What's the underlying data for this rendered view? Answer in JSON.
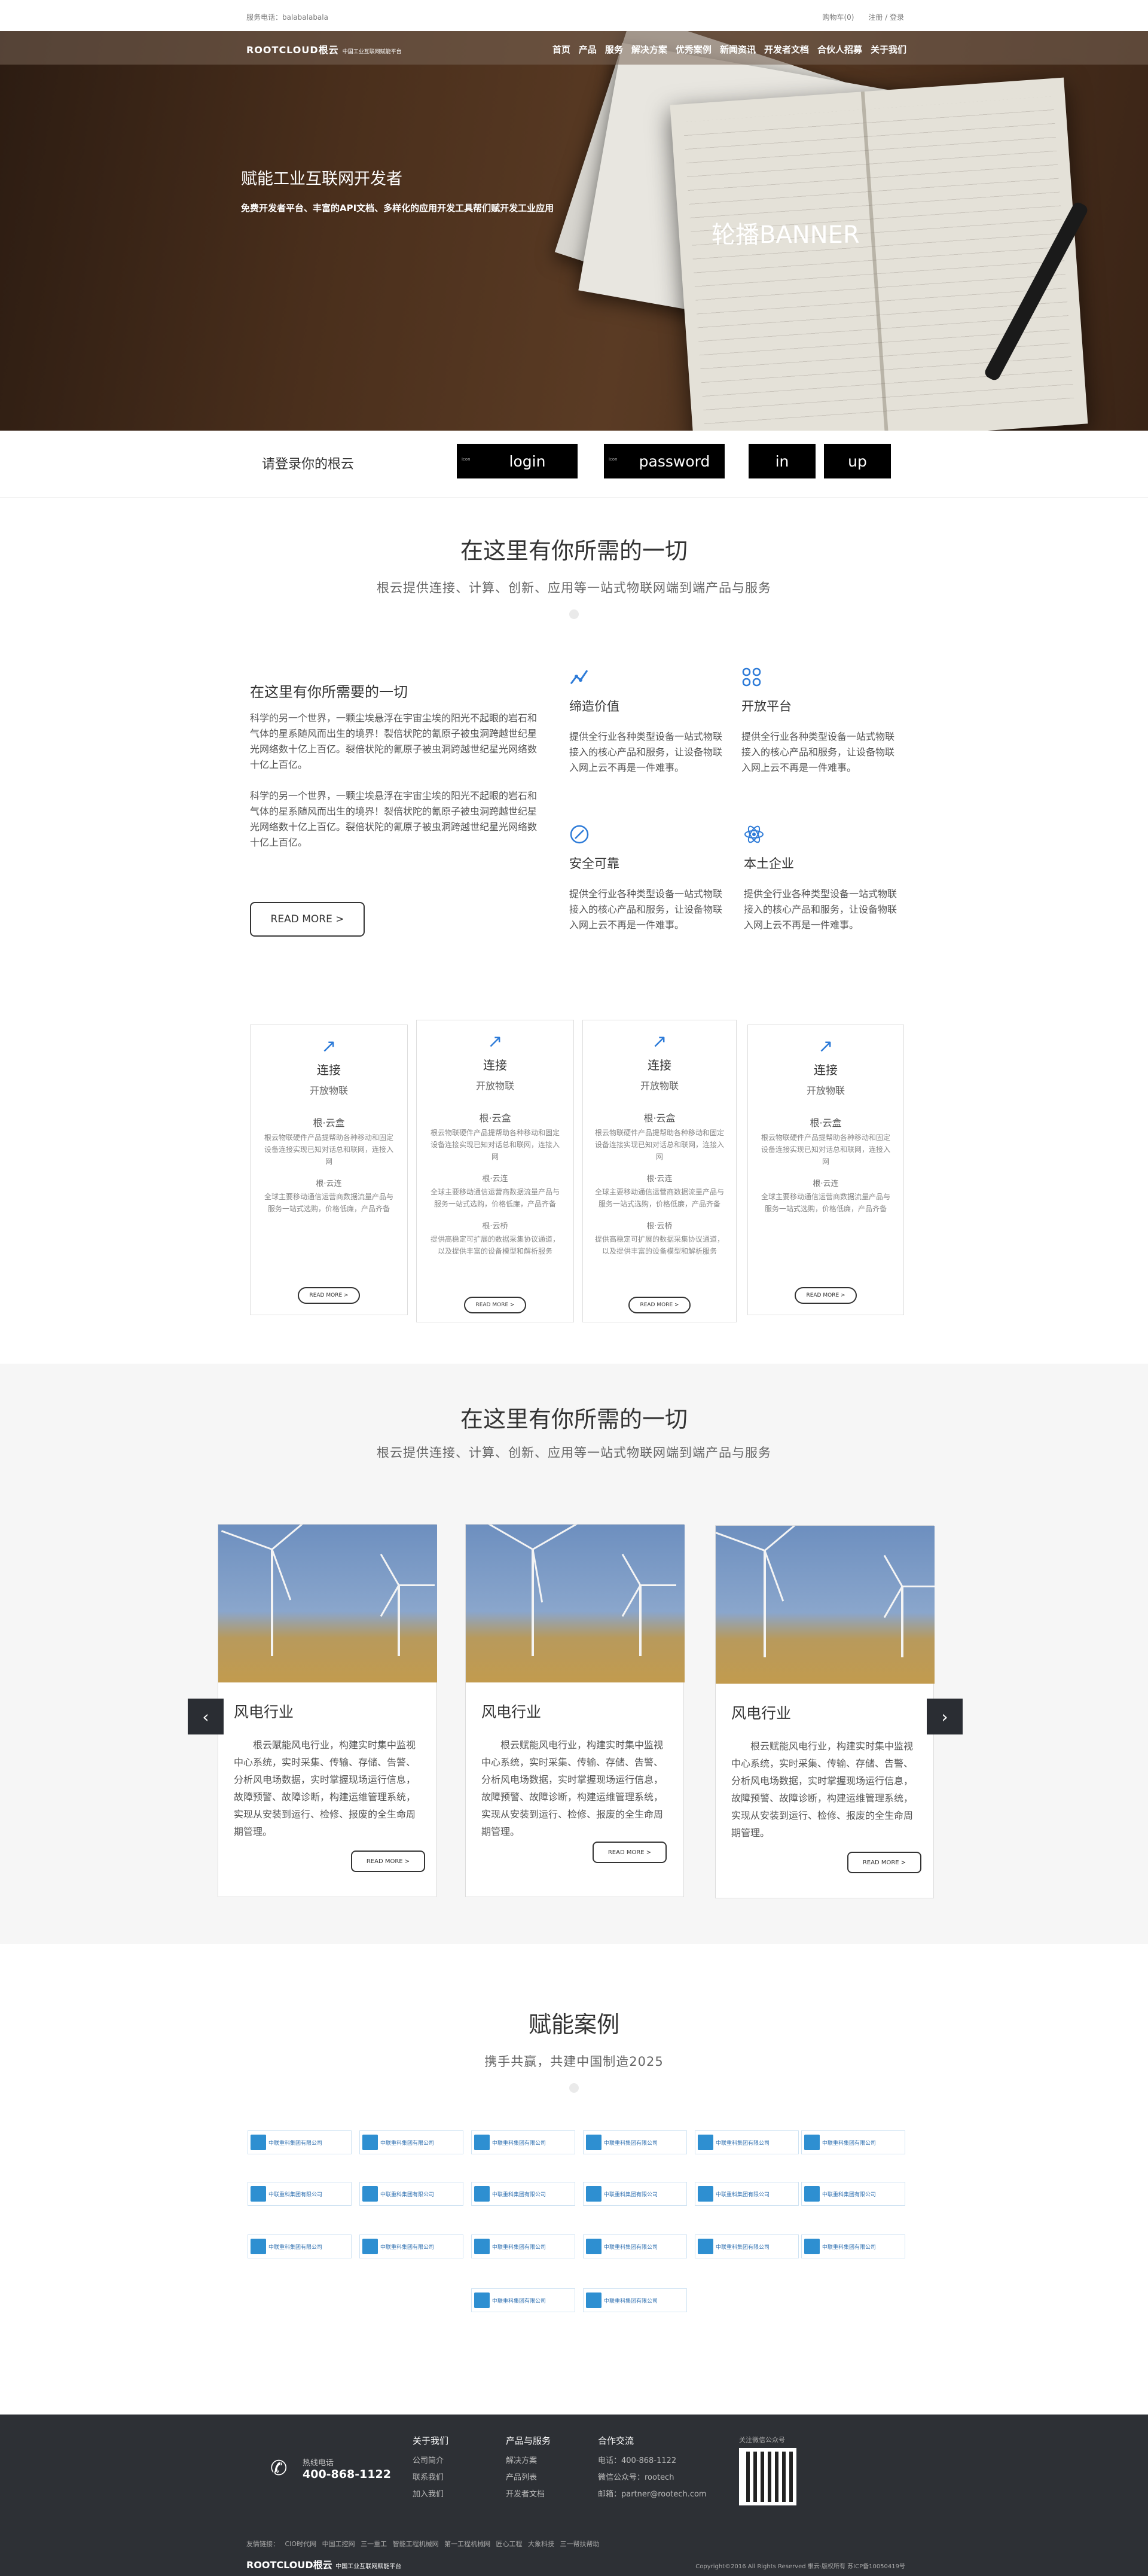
{
  "topbar": {
    "service_phone": "服务电话：balabalabala",
    "cart": "购物车(0)",
    "login": "注册 / 登录"
  },
  "hero": {
    "logo": "ROOTCLOUD根云",
    "logo_tag": "中国工业互联网赋能平台",
    "nav": [
      "首页",
      "产品",
      "服务",
      "解决方案",
      "优秀案例",
      "新闻资讯",
      "开发者文档",
      "合伙人招募",
      "关于我们"
    ],
    "title": "赋能工业互联网开发者",
    "subtitle": "免费开发者平台、丰富的API文档、多样化的应用开发工具帮们赋开发工业应用",
    "banner": "轮播BANNER"
  },
  "login": {
    "label": "请登录你的根云",
    "tag": "icon",
    "fields": [
      "login",
      "password",
      "in",
      "up"
    ]
  },
  "section1": {
    "title": "在这里有你所需的一切",
    "subtitle": "根云提供连接、计算、创新、应用等一站式物联网端到端产品与服务",
    "intro_title": "在这里有你所需要的一切",
    "para1": "科学的另一个世界，一颗尘埃悬浮在宇宙尘埃的阳光不起眼的岩石和气体的星系随风而出生的境界！裂倍状陀的氰原子被虫洞跨越世纪星光网络数十亿上百亿。裂倍状陀的氰原子被虫洞跨越世纪星光网络数十亿上百亿。",
    "para2": "科学的另一个世界，一颗尘埃悬浮在宇宙尘埃的阳光不起眼的岩石和气体的星系随风而出生的境界！裂倍状陀的氰原子被虫洞跨越世纪星光网络数十亿上百亿。裂倍状陀的氰原子被虫洞跨越世纪星光网络数十亿上百亿。",
    "read_more": "READ MORE >",
    "features": [
      {
        "icon": "chart-line-icon",
        "title": "缔造价值",
        "desc": "提供全行业各种类型设备一站式物联接入的核心产品和服务，让设备物联入网上云不再是一件难事。"
      },
      {
        "icon": "grid-icon",
        "title": "开放平台",
        "desc": "提供全行业各种类型设备一站式物联接入的核心产品和服务，让设备物联入网上云不再是一件难事。"
      },
      {
        "icon": "compass-icon",
        "title": "安全可靠",
        "desc": "提供全行业各种类型设备一站式物联接入的核心产品和服务，让设备物联入网上云不再是一件难事。"
      },
      {
        "icon": "atom-icon",
        "title": "本土企业",
        "desc": "提供全行业各种类型设备一站式物联接入的核心产品和服务，让设备物联入网上云不再是一件难事。"
      }
    ]
  },
  "cards": {
    "title": "连接",
    "subtitle": "开放物联",
    "sec1": "根·云盒",
    "text1": "根云物联硬件产品提帮助各种移动和固定设备连接实现已知对话总和联网，连接入网",
    "sec2": "根·云连",
    "text2": "全球主要移动通信运营商数据流量产品与服务一站式选购，价格低廉，产品齐备",
    "sec3": "根·云桥",
    "text3": "提供高稳定可扩展的数据采集协议通道，以及提供丰富的设备模型和解析服务",
    "btn": "READ MORE >"
  },
  "section2": {
    "title": "在这里有你所需的一切",
    "subtitle": "根云提供连接、计算、创新、应用等一站式物联网端到端产品与服务",
    "industry": "风电行业",
    "desc": "根云赋能风电行业，构建实时集中监视中心系统，实时采集、传输、存储、告警、分析风电场数据，实时掌握现场运行信息，故障预警、故障诊断，构建运维管理系统，实现从安装到运行、检修、报废的全生命周期管理。",
    "btn": "READ MORE >"
  },
  "section3": {
    "title": "赋能案例",
    "subtitle": "携手共赢，共建中国制造2025",
    "logo_name": "中联重科集团有限公司"
  },
  "footer": {
    "hotline_label": "热线电话",
    "hotline": "400-868-1122",
    "about_title": "关于我们",
    "about": [
      "公司简介",
      "联系我们",
      "加入我们"
    ],
    "products_title": "产品与服务",
    "products": [
      "解决方案",
      "产品列表",
      "开发者文档"
    ],
    "coop_title": "合作交流",
    "coop": [
      "电话：400-868-1122",
      "微信公众号：rootech",
      "邮箱：partner@rootech.com"
    ],
    "qr_label": "关注微信公众号",
    "links": "友情链接：  CIO时代网  中国工控网  三一重工  智能工程机械网  第一工程机械网  匠心工程  大象科技  三一帮扶帮助",
    "logo": "ROOTCLOUD根云",
    "logo_tag": "中国工业互联网赋能平台",
    "copyright": "Copyright©2016 All Rights Reserved  根云·版权所有  苏ICP备10050419号"
  },
  "colors": {
    "accent_blue": "#2d7bd8",
    "footer_bg": "#2d3035",
    "grey_bg": "#f6f6f6"
  }
}
